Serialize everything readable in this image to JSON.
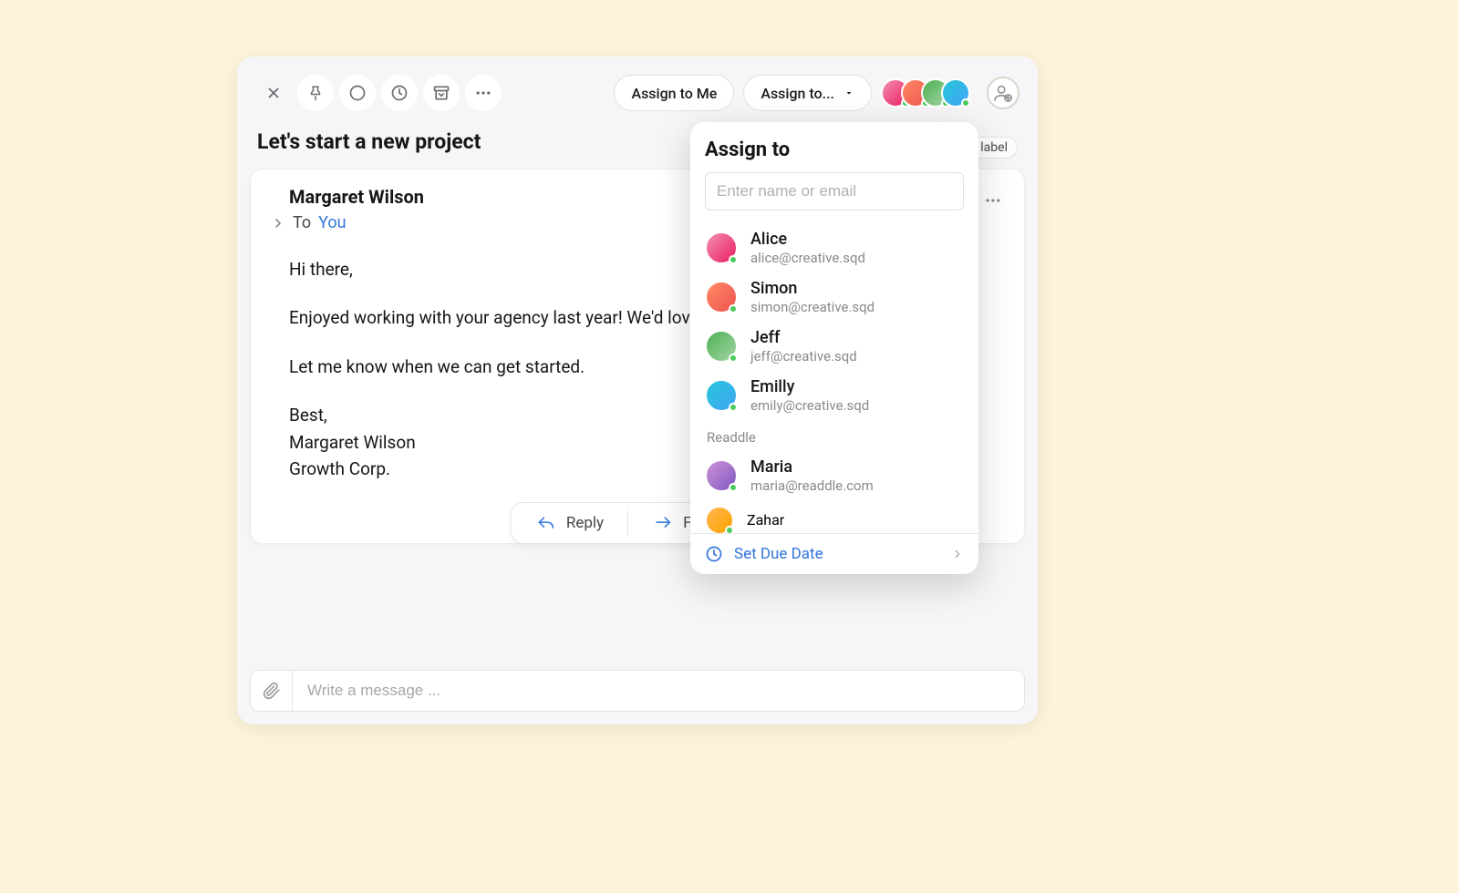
{
  "toolbar": {
    "assign_me_label": "Assign to Me",
    "assign_to_label": "Assign to..."
  },
  "label_chip": "label",
  "subject": "Let's start a new project",
  "email": {
    "sender": "Margaret Wilson",
    "to_prefix": "To",
    "to_name": "You",
    "body_greeting": "Hi there,",
    "body_p1": "Enjoyed working with your agency last year! We'd love website for us.",
    "body_p2": "Let me know when we can get started.",
    "body_signoff": "Best,",
    "body_sig_name": "Margaret Wilson",
    "body_sig_co": "Growth Corp."
  },
  "actions": {
    "reply": "Reply",
    "forward": "Forward"
  },
  "composer": {
    "placeholder": "Write a message ..."
  },
  "assign_popover": {
    "title": "Assign to",
    "search_placeholder": "Enter name or email",
    "contacts": [
      {
        "name": "Alice",
        "email": "alice@creative.sqd",
        "grad": "g1"
      },
      {
        "name": "Simon",
        "email": "simon@creative.sqd",
        "grad": "g2"
      },
      {
        "name": "Jeff",
        "email": "jeff@creative.sqd",
        "grad": "g3"
      },
      {
        "name": "Emilly",
        "email": "emily@creative.sqd",
        "grad": "g4"
      }
    ],
    "group_label": "Readdle",
    "group_contacts": [
      {
        "name": "Maria",
        "email": "maria@readdle.com",
        "grad": "g5"
      },
      {
        "name": "Zahar",
        "email": "",
        "grad": "g6"
      }
    ],
    "due_date_label": "Set Due Date"
  }
}
